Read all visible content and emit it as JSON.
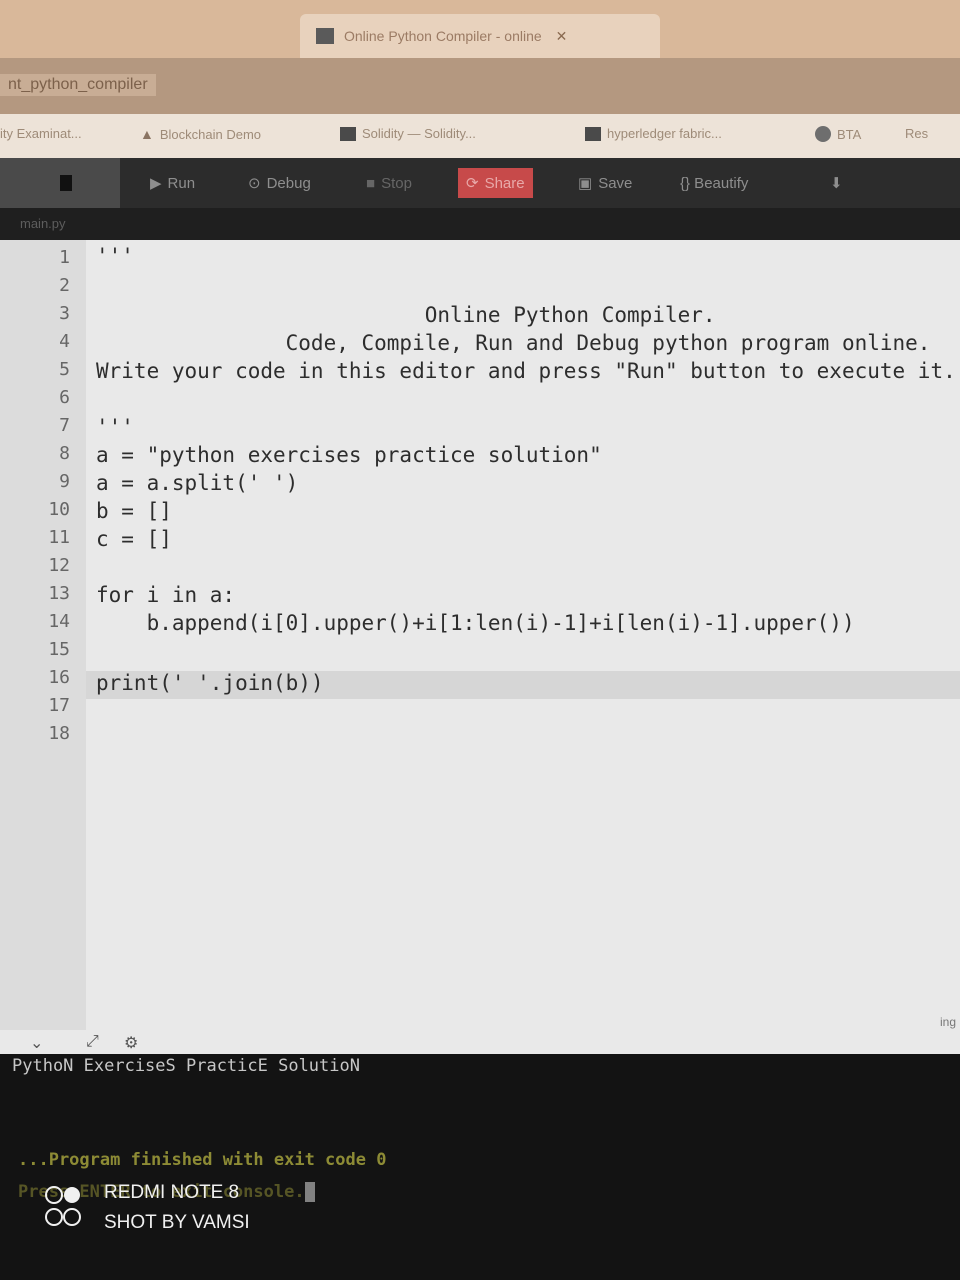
{
  "browser": {
    "tab_title": "Online Python Compiler - online",
    "tab_close": "✕",
    "url": "nt_python_compiler",
    "bookmarks": [
      {
        "label": "ity Examinat..."
      },
      {
        "label": "Blockchain Demo"
      },
      {
        "label": "Solidity — Solidity..."
      },
      {
        "label": "hyperledger fabric..."
      },
      {
        "label": "BTA"
      },
      {
        "label": "Res"
      }
    ]
  },
  "toolbar": {
    "run": "Run",
    "debug": "Debug",
    "stop": "Stop",
    "share": "Share",
    "save": "Save",
    "beautify": "{} Beautify"
  },
  "file_tab": "main.py",
  "editor": {
    "line_numbers": [
      "1",
      "2",
      "3",
      "4",
      "5",
      "6",
      "7",
      "8",
      "9",
      "10",
      "11",
      "12",
      "13",
      "14",
      "15",
      "16",
      "17",
      "18"
    ],
    "lines": [
      "'''",
      "",
      "                          Online Python Compiler.",
      "               Code, Compile, Run and Debug python program online.",
      "Write your code in this editor and press \"Run\" button to execute it.",
      "",
      "'''",
      "a = \"python exercises practice solution\"",
      "a = a.split(' ')",
      "b = []",
      "c = []",
      "",
      "for i in a:",
      "    b.append(i[0].upper()+i[1:len(i)-1]+i[len(i)-1].upper())",
      "",
      "print(' '.join(b))",
      "",
      ""
    ],
    "corner_hint": "ing"
  },
  "console": {
    "output": "PythoN ExerciseS PracticE SolutioN",
    "finished": "...Program finished with exit code 0",
    "press_enter": "Press ENTER to exit console."
  },
  "watermark": {
    "line1": "REDMI NOTE 8",
    "line2": "SHOT BY VAMSI"
  }
}
